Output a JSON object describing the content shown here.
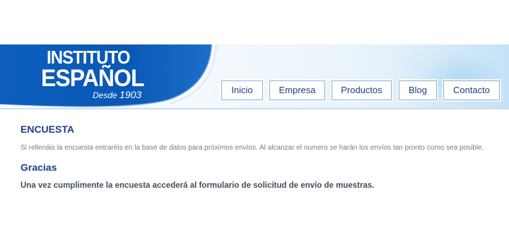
{
  "logo": {
    "line1": "INSTITUTO",
    "line2": "ESPAÑOL",
    "tagline_prefix": "Desde ",
    "tagline_year": "1903",
    "brand_color": "#0a5bb8"
  },
  "nav": {
    "items": [
      {
        "label": "Inicio"
      },
      {
        "label": "Empresa"
      },
      {
        "label": "Productos"
      },
      {
        "label": "Blog"
      },
      {
        "label": "Contacto"
      }
    ]
  },
  "main": {
    "title": "ENCUESTA",
    "intro": "Si rellenáis la encuesta entraréis en la base de datos para próximos envíos. Al alcanzar el numero se harán los envíos tan pronto como sea posible.",
    "subtitle": "Gracias",
    "note": "Una vez cumplimente la encuesta accederá al formulario de solicitud de envío de muestras."
  },
  "colors": {
    "heading": "#1b3f84",
    "body_text": "#6b7f90",
    "nav_border": "#8fb2cf"
  }
}
